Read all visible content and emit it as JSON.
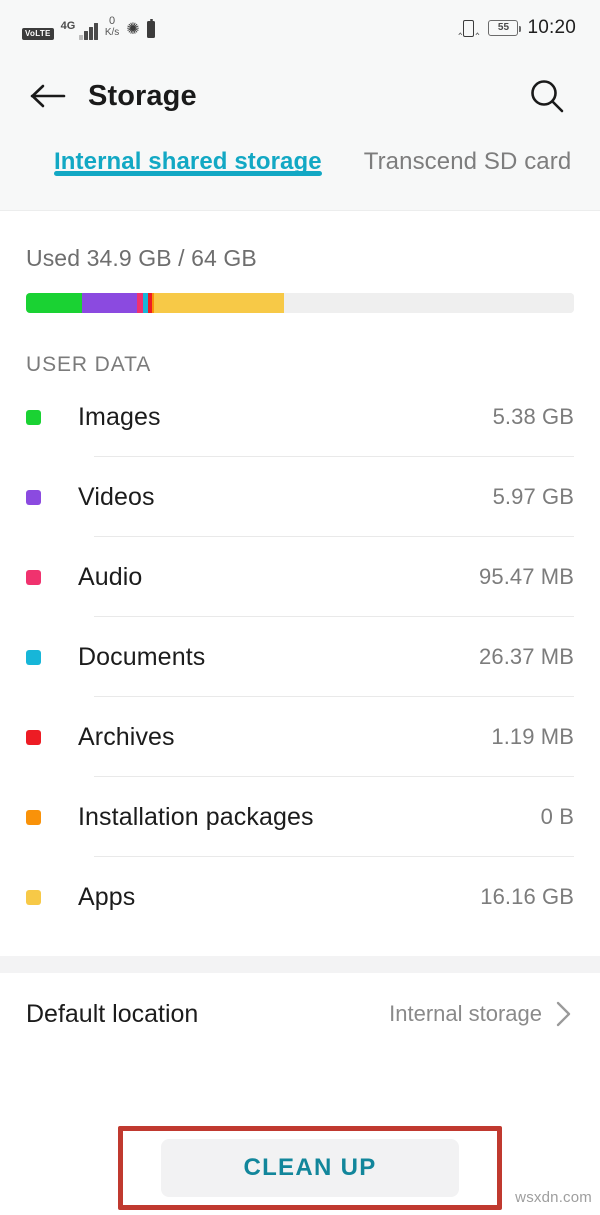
{
  "statusbar": {
    "volte": "VoLTE",
    "network_gen": "4G",
    "data_rate_value": "0",
    "data_rate_unit": "K/s",
    "bluetooth_icon": "bluetooth-icon",
    "sim_icon": "sim-card-icon",
    "vibrate_icon": "vibrate-icon",
    "battery_percent": "55",
    "time": "10:20"
  },
  "appbar": {
    "back_icon": "back-arrow-icon",
    "title": "Storage",
    "search_icon": "search-icon"
  },
  "tabs": [
    {
      "label": "Internal shared storage",
      "active": true
    },
    {
      "label": "Transcend SD card",
      "active": false
    }
  ],
  "usage": {
    "summary": "Used 34.9 GB / 64 GB",
    "used": "34.9 GB",
    "total": "64 GB"
  },
  "section": {
    "user_data_title": "USER DATA"
  },
  "categories": [
    {
      "name": "Images",
      "size": "5.38 GB",
      "color": "#1ad233"
    },
    {
      "name": "Videos",
      "size": "5.97 GB",
      "color": "#8b4ae0"
    },
    {
      "name": "Audio",
      "size": "95.47 MB",
      "color": "#f0326e"
    },
    {
      "name": "Documents",
      "size": "26.37 MB",
      "color": "#17b6d8"
    },
    {
      "name": "Archives",
      "size": "1.19 MB",
      "color": "#ed1c24"
    },
    {
      "name": "Installation packages",
      "size": "0 B",
      "color": "#f99209"
    },
    {
      "name": "Apps",
      "size": "16.16 GB",
      "color": "#f7c947"
    }
  ],
  "default_location": {
    "label": "Default location",
    "value": "Internal storage",
    "chevron_icon": "chevron-right-icon"
  },
  "actions": {
    "clean_up_label": "CLEAN UP"
  },
  "watermark": "wsxdn.com",
  "colors": {
    "accent_teal": "#12a8c4",
    "button_text": "#12869b",
    "annotation_red": "#c0392f",
    "track_empty": "#efefef"
  },
  "chart_data": {
    "type": "bar",
    "title": "Used 34.9 GB / 64 GB",
    "orientation": "horizontal-stacked",
    "total_capacity_gb": 64,
    "used_gb": 34.9,
    "categories": [
      "Images",
      "Videos",
      "Audio",
      "Documents",
      "Archives",
      "Installation packages",
      "Apps",
      "Free"
    ],
    "values_gb": [
      5.38,
      5.97,
      0.0932,
      0.0257,
      0.00116,
      0,
      16.16,
      29.1
    ],
    "colors": [
      "#1ad233",
      "#8b4ae0",
      "#f0326e",
      "#17b6d8",
      "#ed1c24",
      "#f99209",
      "#f7c947",
      "#efefef"
    ],
    "segment_widths_pct": [
      10.2,
      10.1,
      1.0,
      0.9,
      0.8,
      0.4,
      23.6,
      53.0
    ],
    "grid": false,
    "legend": "below-as-list"
  }
}
